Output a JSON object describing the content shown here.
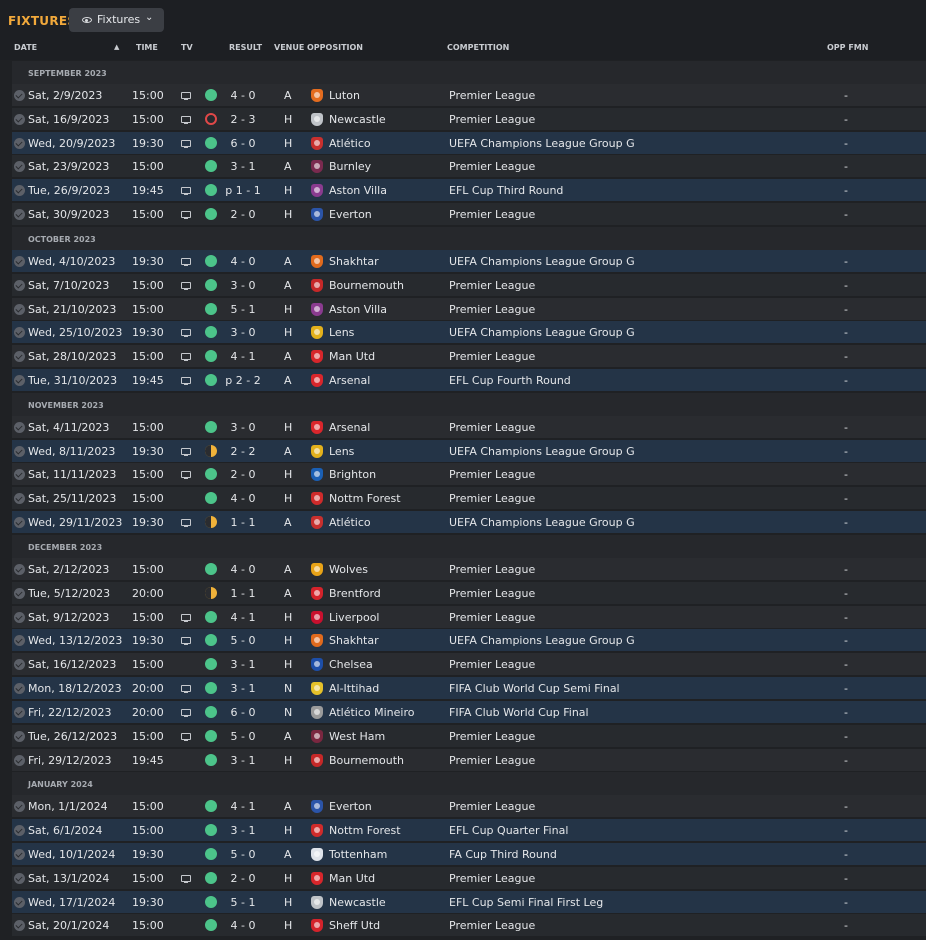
{
  "header": {
    "title": "FIXTURES",
    "view_button_label": "Fixtures"
  },
  "columns": {
    "date": "DATE",
    "time": "TIME",
    "tv": "TV",
    "result": "RESULT",
    "venue": "VENUE",
    "opposition": "OPPOSITION",
    "competition": "COMPETITION",
    "opp_fmn": "OPP FMN"
  },
  "colors": {
    "accent": "#f2a93b",
    "win": "#4cc48a",
    "draw": "#f0b23a",
    "loss": "#e04848",
    "row_highlight": "#243447"
  },
  "groups": [
    {
      "label": "SEPTEMBER 2023",
      "rows": [
        {
          "date": "Sat, 2/9/2023",
          "time": "15:00",
          "tv": true,
          "outcome": "W",
          "score": "4 - 0",
          "venue": "A",
          "opponent": "Luton",
          "crest": "#e46c1f",
          "competition": "Premier League",
          "hl": false,
          "fmn": "-"
        },
        {
          "date": "Sat, 16/9/2023",
          "time": "15:00",
          "tv": true,
          "outcome": "L",
          "score": "2 - 3",
          "venue": "H",
          "opponent": "Newcastle",
          "crest": "#bfc3c8",
          "competition": "Premier League",
          "hl": false,
          "fmn": "-"
        },
        {
          "date": "Wed, 20/9/2023",
          "time": "19:30",
          "tv": true,
          "outcome": "W",
          "score": "6 - 0",
          "venue": "H",
          "opponent": "Atlético",
          "crest": "#c8302e",
          "competition": "UEFA Champions League Group G",
          "hl": true,
          "fmn": "-"
        },
        {
          "date": "Sat, 23/9/2023",
          "time": "15:00",
          "tv": false,
          "outcome": "W",
          "score": "3 - 1",
          "venue": "A",
          "opponent": "Burnley",
          "crest": "#7a2a4f",
          "competition": "Premier League",
          "hl": false,
          "fmn": "-"
        },
        {
          "date": "Tue, 26/9/2023",
          "time": "19:45",
          "tv": true,
          "outcome": "W",
          "score": "p 1 - 1",
          "venue": "H",
          "opponent": "Aston Villa",
          "crest": "#8a3b8f",
          "competition": "EFL Cup Third Round",
          "hl": true,
          "fmn": "-"
        },
        {
          "date": "Sat, 30/9/2023",
          "time": "15:00",
          "tv": true,
          "outcome": "W",
          "score": "2 - 0",
          "venue": "H",
          "opponent": "Everton",
          "crest": "#2b54a8",
          "competition": "Premier League",
          "hl": false,
          "fmn": "-"
        }
      ]
    },
    {
      "label": "OCTOBER 2023",
      "rows": [
        {
          "date": "Wed, 4/10/2023",
          "time": "19:30",
          "tv": true,
          "outcome": "W",
          "score": "4 - 0",
          "venue": "A",
          "opponent": "Shakhtar",
          "crest": "#e06a1d",
          "competition": "UEFA Champions League Group G",
          "hl": true,
          "fmn": "-"
        },
        {
          "date": "Sat, 7/10/2023",
          "time": "15:00",
          "tv": true,
          "outcome": "W",
          "score": "3 - 0",
          "venue": "A",
          "opponent": "Bournemouth",
          "crest": "#c62828",
          "competition": "Premier League",
          "hl": false,
          "fmn": "-"
        },
        {
          "date": "Sat, 21/10/2023",
          "time": "15:00",
          "tv": false,
          "outcome": "W",
          "score": "5 - 1",
          "venue": "H",
          "opponent": "Aston Villa",
          "crest": "#8a3b8f",
          "competition": "Premier League",
          "hl": false,
          "fmn": "-"
        },
        {
          "date": "Wed, 25/10/2023",
          "time": "19:30",
          "tv": true,
          "outcome": "W",
          "score": "3 - 0",
          "venue": "H",
          "opponent": "Lens",
          "crest": "#e3b11c",
          "competition": "UEFA Champions League Group G",
          "hl": true,
          "fmn": "-"
        },
        {
          "date": "Sat, 28/10/2023",
          "time": "15:00",
          "tv": true,
          "outcome": "W",
          "score": "4 - 1",
          "venue": "A",
          "opponent": "Man Utd",
          "crest": "#d7262b",
          "competition": "Premier League",
          "hl": false,
          "fmn": "-"
        },
        {
          "date": "Tue, 31/10/2023",
          "time": "19:45",
          "tv": true,
          "outcome": "W",
          "score": "p 2 - 2",
          "venue": "A",
          "opponent": "Arsenal",
          "crest": "#d9262c",
          "competition": "EFL Cup Fourth Round",
          "hl": true,
          "fmn": "-"
        }
      ]
    },
    {
      "label": "NOVEMBER 2023",
      "rows": [
        {
          "date": "Sat, 4/11/2023",
          "time": "15:00",
          "tv": false,
          "outcome": "W",
          "score": "3 - 0",
          "venue": "H",
          "opponent": "Arsenal",
          "crest": "#d9262c",
          "competition": "Premier League",
          "hl": false,
          "fmn": "-"
        },
        {
          "date": "Wed, 8/11/2023",
          "time": "19:30",
          "tv": true,
          "outcome": "D",
          "score": "2 - 2",
          "venue": "A",
          "opponent": "Lens",
          "crest": "#e3b11c",
          "competition": "UEFA Champions League Group G",
          "hl": true,
          "fmn": "-"
        },
        {
          "date": "Sat, 11/11/2023",
          "time": "15:00",
          "tv": true,
          "outcome": "W",
          "score": "2 - 0",
          "venue": "H",
          "opponent": "Brighton",
          "crest": "#1a5fb4",
          "competition": "Premier League",
          "hl": false,
          "fmn": "-"
        },
        {
          "date": "Sat, 25/11/2023",
          "time": "15:00",
          "tv": false,
          "outcome": "W",
          "score": "4 - 0",
          "venue": "H",
          "opponent": "Nottm Forest",
          "crest": "#cf2b2b",
          "competition": "Premier League",
          "hl": false,
          "fmn": "-"
        },
        {
          "date": "Wed, 29/11/2023",
          "time": "19:30",
          "tv": true,
          "outcome": "D",
          "score": "1 - 1",
          "venue": "A",
          "opponent": "Atlético",
          "crest": "#c8302e",
          "competition": "UEFA Champions League Group G",
          "hl": true,
          "fmn": "-"
        }
      ]
    },
    {
      "label": "DECEMBER 2023",
      "rows": [
        {
          "date": "Sat, 2/12/2023",
          "time": "15:00",
          "tv": false,
          "outcome": "W",
          "score": "4 - 0",
          "venue": "A",
          "opponent": "Wolves",
          "crest": "#e8a317",
          "competition": "Premier League",
          "hl": false,
          "fmn": "-"
        },
        {
          "date": "Tue, 5/12/2023",
          "time": "20:00",
          "tv": false,
          "outcome": "D",
          "score": "1 - 1",
          "venue": "A",
          "opponent": "Brentford",
          "crest": "#d4232b",
          "competition": "Premier League",
          "hl": false,
          "fmn": "-"
        },
        {
          "date": "Sat, 9/12/2023",
          "time": "15:00",
          "tv": true,
          "outcome": "W",
          "score": "4 - 1",
          "venue": "H",
          "opponent": "Liverpool",
          "crest": "#c8102e",
          "competition": "Premier League",
          "hl": false,
          "fmn": "-"
        },
        {
          "date": "Wed, 13/12/2023",
          "time": "19:30",
          "tv": true,
          "outcome": "W",
          "score": "5 - 0",
          "venue": "H",
          "opponent": "Shakhtar",
          "crest": "#e06a1d",
          "competition": "UEFA Champions League Group G",
          "hl": true,
          "fmn": "-"
        },
        {
          "date": "Sat, 16/12/2023",
          "time": "15:00",
          "tv": false,
          "outcome": "W",
          "score": "3 - 1",
          "venue": "H",
          "opponent": "Chelsea",
          "crest": "#1d4ea8",
          "competition": "Premier League",
          "hl": false,
          "fmn": "-"
        },
        {
          "date": "Mon, 18/12/2023",
          "time": "20:00",
          "tv": true,
          "outcome": "W",
          "score": "3 - 1",
          "venue": "N",
          "opponent": "Al-Ittihad",
          "crest": "#e5c12a",
          "competition": "FIFA Club World Cup Semi Final",
          "hl": true,
          "fmn": "-"
        },
        {
          "date": "Fri, 22/12/2023",
          "time": "20:00",
          "tv": true,
          "outcome": "W",
          "score": "6 - 0",
          "venue": "N",
          "opponent": "Atlético Mineiro",
          "crest": "#9b9b9b",
          "competition": "FIFA Club World Cup Final",
          "hl": true,
          "fmn": "-"
        },
        {
          "date": "Tue, 26/12/2023",
          "time": "15:00",
          "tv": true,
          "outcome": "W",
          "score": "5 - 0",
          "venue": "A",
          "opponent": "West Ham",
          "crest": "#7a2740",
          "competition": "Premier League",
          "hl": false,
          "fmn": "-"
        },
        {
          "date": "Fri, 29/12/2023",
          "time": "19:45",
          "tv": false,
          "outcome": "W",
          "score": "3 - 1",
          "venue": "H",
          "opponent": "Bournemouth",
          "crest": "#c62828",
          "competition": "Premier League",
          "hl": false,
          "fmn": "-"
        }
      ]
    },
    {
      "label": "JANUARY 2024",
      "rows": [
        {
          "date": "Mon, 1/1/2024",
          "time": "15:00",
          "tv": false,
          "outcome": "W",
          "score": "4 - 1",
          "venue": "A",
          "opponent": "Everton",
          "crest": "#2b54a8",
          "competition": "Premier League",
          "hl": false,
          "fmn": "-"
        },
        {
          "date": "Sat, 6/1/2024",
          "time": "15:00",
          "tv": false,
          "outcome": "W",
          "score": "3 - 1",
          "venue": "H",
          "opponent": "Nottm Forest",
          "crest": "#cf2b2b",
          "competition": "EFL Cup Quarter Final",
          "hl": true,
          "fmn": "-"
        },
        {
          "date": "Wed, 10/1/2024",
          "time": "19:30",
          "tv": false,
          "outcome": "W",
          "score": "5 - 0",
          "venue": "A",
          "opponent": "Tottenham",
          "crest": "#dfe3ea",
          "competition": "FA Cup Third Round",
          "hl": true,
          "fmn": "-"
        },
        {
          "date": "Sat, 13/1/2024",
          "time": "15:00",
          "tv": true,
          "outcome": "W",
          "score": "2 - 0",
          "venue": "H",
          "opponent": "Man Utd",
          "crest": "#d7262b",
          "competition": "Premier League",
          "hl": false,
          "fmn": "-"
        },
        {
          "date": "Wed, 17/1/2024",
          "time": "19:30",
          "tv": false,
          "outcome": "W",
          "score": "5 - 1",
          "venue": "H",
          "opponent": "Newcastle",
          "crest": "#bfc3c8",
          "competition": "EFL Cup Semi Final First Leg",
          "hl": true,
          "fmn": "-"
        },
        {
          "date": "Sat, 20/1/2024",
          "time": "15:00",
          "tv": false,
          "outcome": "W",
          "score": "4 - 0",
          "venue": "H",
          "opponent": "Sheff Utd",
          "crest": "#d4232b",
          "competition": "Premier League",
          "hl": false,
          "fmn": "-"
        }
      ]
    }
  ]
}
